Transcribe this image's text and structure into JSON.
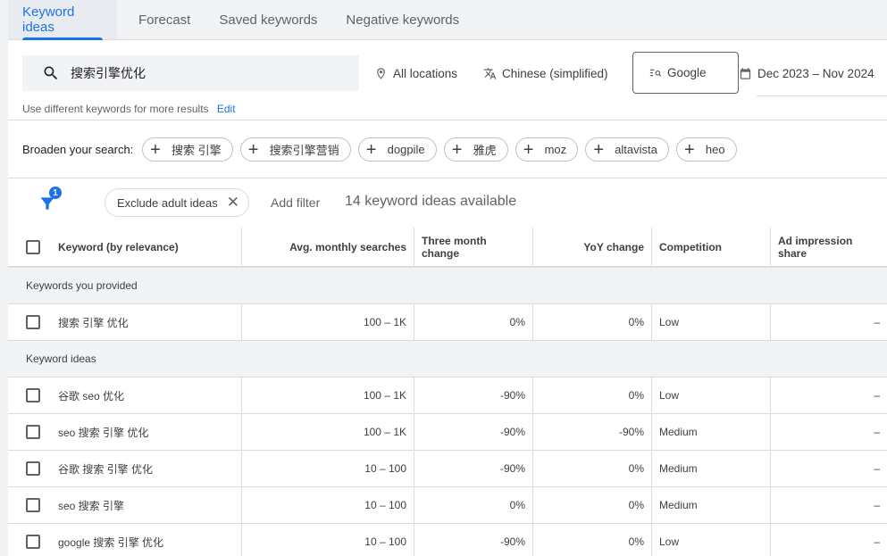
{
  "tabs": [
    {
      "label": "Keyword ideas",
      "active": true
    },
    {
      "label": "Forecast",
      "active": false
    },
    {
      "label": "Saved keywords",
      "active": false
    },
    {
      "label": "Negative keywords",
      "active": false
    }
  ],
  "search": {
    "icon": "search-icon",
    "value": "搜索引擎优化",
    "hint": "Use different keywords for more results",
    "edit_label": "Edit"
  },
  "options": {
    "location": {
      "icon": "location-pin-icon",
      "label": "All locations"
    },
    "language": {
      "icon": "translate-icon",
      "label": "Chinese (simplified)"
    },
    "network": {
      "icon": "search-network-icon",
      "label": "Google"
    },
    "date": {
      "icon": "calendar-icon",
      "label": "Dec 2023 – Nov 2024"
    }
  },
  "broaden": {
    "label": "Broaden your search:",
    "chips": [
      "搜索 引擎",
      "搜索引擎营销",
      "dogpile",
      "雅虎",
      "moz",
      "altavista",
      "heo"
    ]
  },
  "filters": {
    "icon": "filter-icon",
    "badge_count": "1",
    "active_filter": "Exclude adult ideas",
    "add_filter_label": "Add filter",
    "count_text": "14 keyword ideas available"
  },
  "table": {
    "columns": [
      "Keyword (by relevance)",
      "Avg. monthly searches",
      "Three month change",
      "YoY change",
      "Competition",
      "Ad impression share"
    ],
    "groups": [
      {
        "label": "Keywords you provided",
        "rows": [
          {
            "keyword": "搜索 引擎 优化",
            "avg": "100 – 1K",
            "three_month": "0%",
            "yoy": "0%",
            "competition": "Low",
            "ad_share": "–"
          }
        ]
      },
      {
        "label": "Keyword ideas",
        "rows": [
          {
            "keyword": "谷歌 seo 优化",
            "avg": "100 – 1K",
            "three_month": "-90%",
            "yoy": "0%",
            "competition": "Low",
            "ad_share": "–"
          },
          {
            "keyword": "seo 搜索 引擎 优化",
            "avg": "100 – 1K",
            "three_month": "-90%",
            "yoy": "-90%",
            "competition": "Medium",
            "ad_share": "–"
          },
          {
            "keyword": "谷歌 搜索 引擎 优化",
            "avg": "10 – 100",
            "three_month": "-90%",
            "yoy": "0%",
            "competition": "Medium",
            "ad_share": "–"
          },
          {
            "keyword": "seo 搜索 引擎",
            "avg": "10 – 100",
            "three_month": "0%",
            "yoy": "0%",
            "competition": "Medium",
            "ad_share": "–"
          },
          {
            "keyword": "google 搜索 引擎 优化",
            "avg": "10 – 100",
            "three_month": "-90%",
            "yoy": "0%",
            "competition": "Low",
            "ad_share": "–"
          }
        ]
      }
    ]
  },
  "colors": {
    "accent": "#1a73e8",
    "tab_bg": "#f1f3f4",
    "active_tab_bg": "#e8ecf0",
    "border": "#dadce0"
  }
}
